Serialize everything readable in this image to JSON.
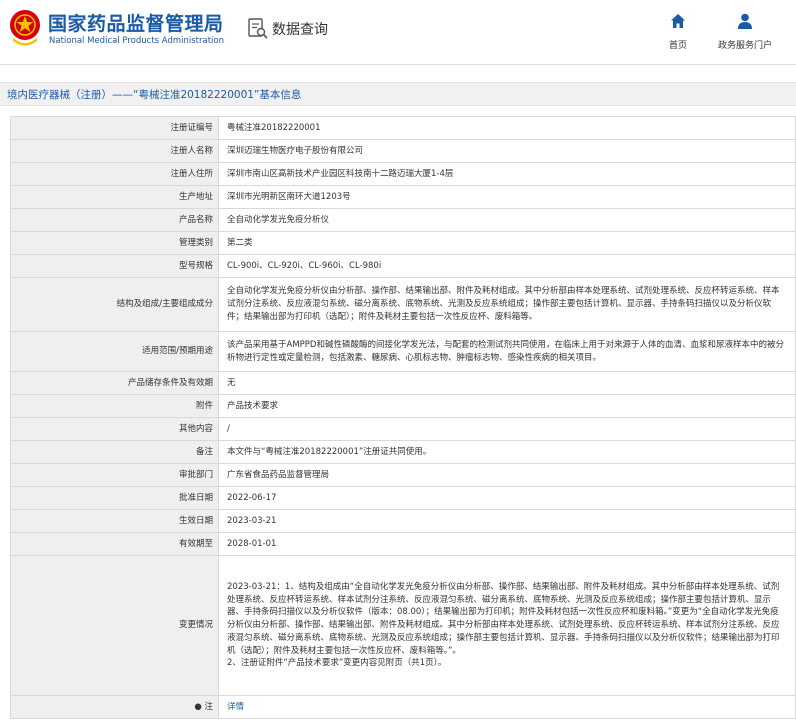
{
  "header": {
    "logo_cn": "国家药品监督管理局",
    "logo_en": "National Medical Products Administration",
    "data_query": "数据查询",
    "nav": [
      {
        "label": "首页",
        "icon": "home-icon"
      },
      {
        "label": "政务服务门户",
        "icon": "user-icon"
      }
    ]
  },
  "title_bar": "境内医疗器械（注册）——“粤械注准20182220001”基本信息",
  "rows": [
    {
      "key": "注册证编号",
      "value": "粤械注准20182220001"
    },
    {
      "key": "注册人名称",
      "value": "深圳迈瑞生物医疗电子股份有限公司"
    },
    {
      "key": "注册人住所",
      "value": "深圳市南山区高新技术产业园区科技南十二路迈瑞大厦1-4层"
    },
    {
      "key": "生产地址",
      "value": "深圳市光明新区南环大道1203号"
    },
    {
      "key": "产品名称",
      "value": "全自动化学发光免疫分析仪"
    },
    {
      "key": "管理类别",
      "value": "第二类"
    },
    {
      "key": "型号规格",
      "value": "CL-900i、CL-920i、CL-960i、CL-980i"
    },
    {
      "key": "结构及组成/主要组成成分",
      "value": "全自动化学发光免疫分析仪由分析部、操作部、结果输出部、附件及耗材组成。其中分析部由样本处理系统、试剂处理系统、反应杯转运系统、样本试剂分注系统、反应液混匀系统、磁分离系统、底物系统、光测及反应系统组成；操作部主要包括计算机、显示器、手持条码扫描仪以及分析仪软件；结果输出部为打印机（选配）；附件及耗材主要包括一次性反应杯、废料箱等。"
    },
    {
      "key": "适用范围/预期用途",
      "value": "该产品采用基于AMPPD和碱性磷酸酶的间接化学发光法，与配套的检测试剂共同使用，在临床上用于对来源于人体的血清、血浆和尿液样本中的被分析物进行定性或定量检测，包括激素、糖尿病、心肌标志物、肿瘤标志物、感染性疾病的相关项目。"
    },
    {
      "key": "产品储存条件及有效期",
      "value": "无"
    },
    {
      "key": "附件",
      "value": "产品技术要求"
    },
    {
      "key": "其他内容",
      "value": "/"
    },
    {
      "key": "备注",
      "value": "本文件与“粤械注准20182220001”注册证共同使用。"
    },
    {
      "key": "审批部门",
      "value": "广东省食品药品监督管理局"
    },
    {
      "key": "批准日期",
      "value": "2022-06-17"
    },
    {
      "key": "生效日期",
      "value": "2023-03-21"
    },
    {
      "key": "有效期至",
      "value": "2028-01-01"
    },
    {
      "key": "变更情况",
      "value": "2023-03-21：1、结构及组成由“全自动化学发光免疫分析仪由分析部、操作部、结果输出部、附件及耗材组成。其中分析部由样本处理系统、试剂处理系统、反应杯转运系统、样本试剂分注系统、反应液混匀系统、磁分离系统、底物系统、光测及反应系统组成；操作部主要包括计算机、显示器、手持条码扫描仪以及分析仪软件（版本：08.00）；结果输出部为打印机；附件及耗材包括一次性反应杯和废料箱。”变更为“全自动化学发光免疫分析仪由分析部、操作部、结果输出部、附件及耗材组成。其中分析部由样本处理系统、试剂处理系统、反应杯转运系统、样本试剂分注系统、反应液混匀系统、磁分离系统、底物系统、光测及反应系统组成；操作部主要包括计算机、显示器、手持条码扫描仪以及分析仪软件；结果输出部为打印机（选配）；附件及耗材主要包括一次性反应杯、废料箱等。”。",
      "value2": "2、注册证附件“产品技术要求”变更内容见附页（共1页）。"
    },
    {
      "key": "注",
      "value": "详情",
      "icon": "star-icon"
    }
  ],
  "colors": {
    "brand_blue": "#1a5aa6",
    "logo_red": "#d7000f"
  }
}
